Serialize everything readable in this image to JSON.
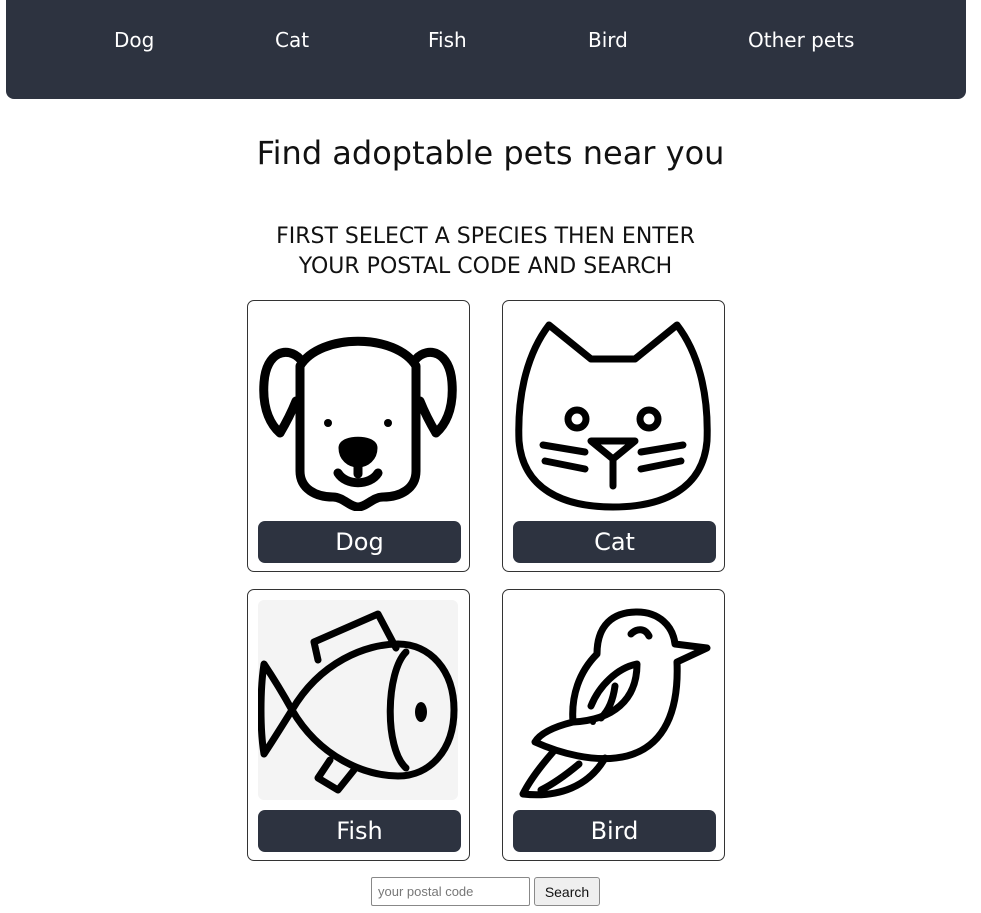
{
  "nav": {
    "items": [
      {
        "label": "Dog"
      },
      {
        "label": "Cat"
      },
      {
        "label": "Fish"
      },
      {
        "label": "Bird"
      },
      {
        "label": "Other pets"
      }
    ]
  },
  "main": {
    "title": "Find adoptable pets near you",
    "instruction_line1": "FIRST SELECT A SPECIES THEN ENTER",
    "instruction_line2": "YOUR POSTAL CODE AND SEARCH"
  },
  "species": [
    {
      "label": "Dog",
      "icon": "dog-icon"
    },
    {
      "label": "Cat",
      "icon": "cat-icon"
    },
    {
      "label": "Fish",
      "icon": "fish-icon",
      "highlighted": true
    },
    {
      "label": "Bird",
      "icon": "bird-icon"
    }
  ],
  "search": {
    "placeholder": "your postal code",
    "value": "",
    "button_label": "Search"
  },
  "colors": {
    "navbar_bg": "#2d3340",
    "button_bg": "#2d3340",
    "highlight_bg": "#f4f4f4"
  }
}
